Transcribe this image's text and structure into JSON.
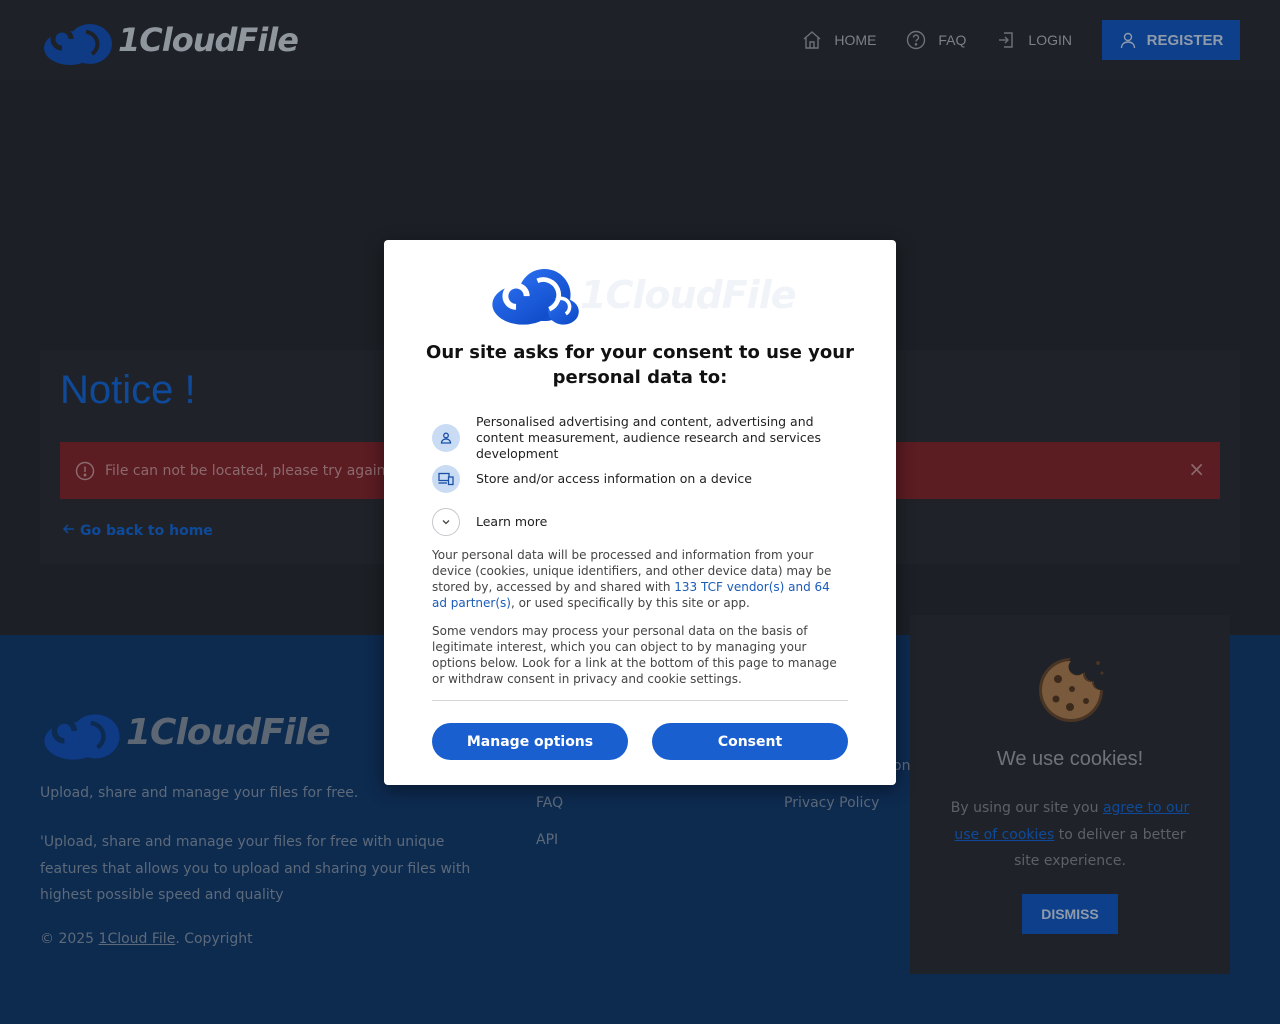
{
  "header": {
    "logo_text": "1CloudFile",
    "nav": [
      {
        "label": "HOME",
        "icon": "home-icon"
      },
      {
        "label": "FAQ",
        "icon": "question-icon"
      },
      {
        "label": "LOGIN",
        "icon": "login-icon"
      }
    ],
    "register_label": "REGISTER"
  },
  "main": {
    "notice_title": "Notice !",
    "alert_text": "File can not be located, please try again la",
    "alert_close": "×",
    "back_link": "Go back to home"
  },
  "footer": {
    "logo_text": "1CloudFile",
    "tagline": "Upload, share and manage your files for free.",
    "description": "'Upload, share and manage your files for free with unique features that allows you to upload and sharing your files with highest possible speed and quality",
    "copyright_prefix": "© 2025 ",
    "copyright_link": "1Cloud File",
    "copyright_suffix": ". Copyright",
    "links_col1": [
      "FAQ",
      "API"
    ],
    "links_col2": [
      "Privacy Policy"
    ],
    "partial_text": "on"
  },
  "cookie_banner": {
    "title": "We use cookies!",
    "text_before": "By using our site you ",
    "link_text": "agree to our use of cookies",
    "text_after": " to deliver a better site experience.",
    "dismiss_label": "DISMISS"
  },
  "consent_dialog": {
    "logo_text": "1CloudFile",
    "heading": "Our site asks for your consent to use your personal data to:",
    "purposes": [
      {
        "icon": "person-icon",
        "text": "Personalised advertising and content, advertising and content measurement, audience research and services development"
      },
      {
        "icon": "devices-icon",
        "text": "Store and/or access information on a device"
      }
    ],
    "learn_more": "Learn more",
    "para1_before": "Your personal data will be processed and information from your device (cookies, unique identifiers, and other device data) may be stored by, accessed by and shared with ",
    "para1_link": "133 TCF vendor(s) and 64 ad partner(s)",
    "para1_after": ", or used specifically by this site or app.",
    "para2": "Some vendors may process your personal data on the basis of legitimate interest, which you can object to by managing your options below. Look for a link at the bottom of this page to manage or withdraw consent in privacy and cookie settings.",
    "manage_label": "Manage options",
    "consent_label": "Consent"
  },
  "colors": {
    "brand_blue": "#1a5fd0",
    "header_bg": "#1e2127",
    "footer_bg": "#0d2a4f",
    "alert_bg": "#5b1c22"
  }
}
